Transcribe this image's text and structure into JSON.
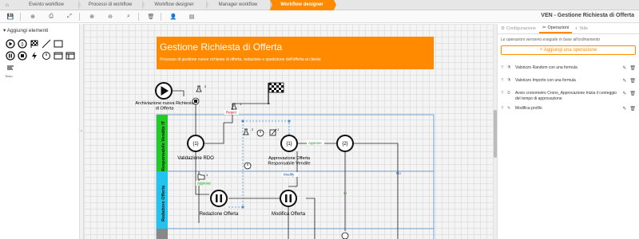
{
  "tabs": {
    "items": [
      "Evento workflow",
      "Processi di workflow",
      "Workflow designer",
      "Manager workflow",
      "Workflow designer"
    ],
    "active_index": 4
  },
  "window_title": "VEN - Gestione Richiesta di Offerta",
  "palette": {
    "header": "Aggiungi elementi",
    "text_label": "Testo"
  },
  "diagram": {
    "title": "Gestione Richiesta di Offerta",
    "subtitle": "Processo di gestione nuove richieste di offerta, redazione e spedizione dell'offerta al cliente",
    "title_color": "#ff8a00",
    "lanes": [
      {
        "label": "Responsabile Vendite IT",
        "color": "#22cc22"
      },
      {
        "label": "Redattore Offerta",
        "color": "#22c4ee"
      },
      {
        "label": "",
        "color": "#888888"
      }
    ],
    "nodes": {
      "start_label": "Archiviazione nuova Richiesta di Offerta",
      "validazione_label": "Validazione RDO",
      "approvazione_label": "Approvazione Offerta Responsabile Vendite",
      "redazione_label": "Redazione Offerta",
      "modifica_label": "Modifica Offerta",
      "task1_text": "{1}",
      "task2_text": "{1}",
      "task3_text": "{2}",
      "badge_start": "2",
      "badge_reject": "1",
      "badge_approve_top": "2",
      "badge_approve_top2": "1",
      "badge_folder": "1"
    },
    "flows": {
      "reject": "Reject",
      "approve_a": "Approve",
      "approve_b": "Approve",
      "modify": "Modify",
      "si": "Sì",
      "no": "No"
    }
  },
  "right_panel": {
    "tabs": [
      "Configurazione",
      "Operazioni",
      "Stile"
    ],
    "active_tab": 1,
    "note": "Le operazioni verranno eseguite in base all'ordinamento",
    "add_button": "+ Aggiungi una operazione",
    "operations": [
      {
        "icon": "flask-icon",
        "text": "Valorizzo Random con una formula"
      },
      {
        "icon": "flask-icon",
        "text": "Valorizzo Importo con una formula"
      },
      {
        "icon": "timer-icon",
        "text": "Avvio cronometro Crono_Approvazione Inizia il conteggio del tempo di approvazione"
      },
      {
        "icon": "edit-icon",
        "text": "Modifica profilo"
      }
    ]
  }
}
